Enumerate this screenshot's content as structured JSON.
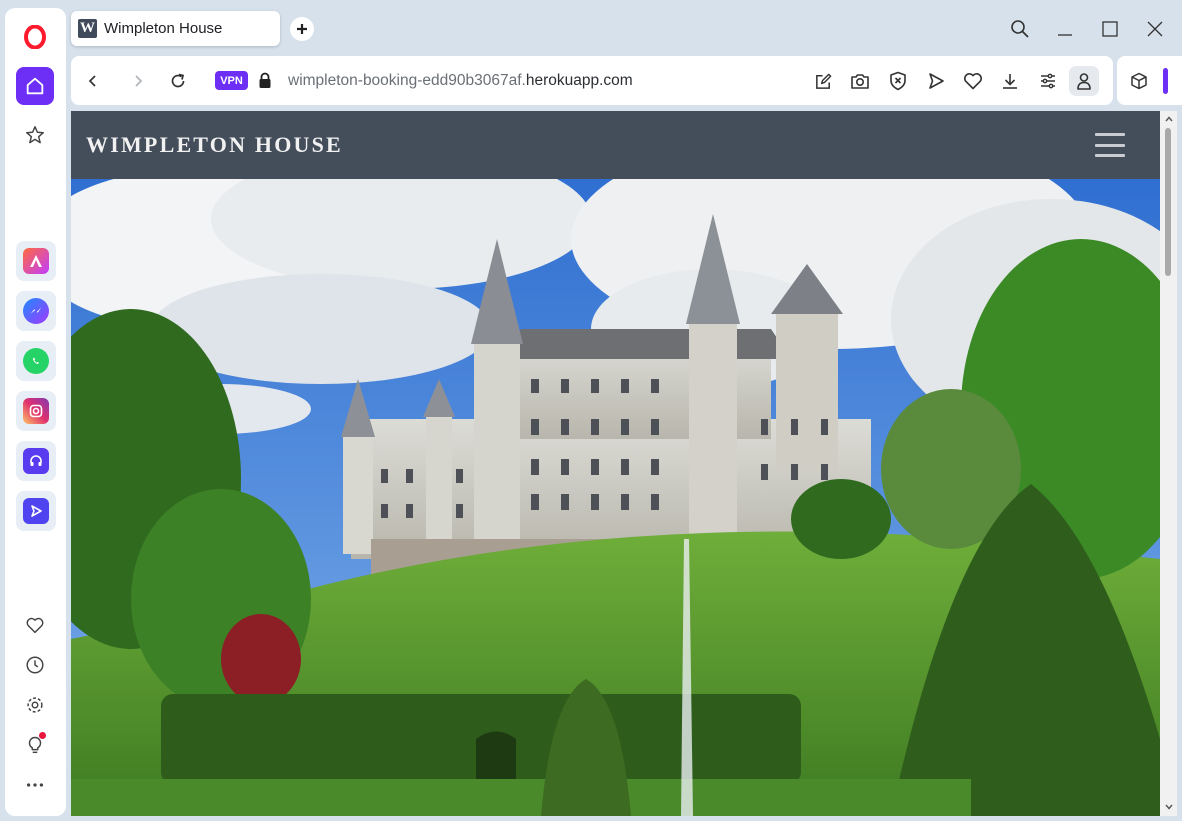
{
  "browser": {
    "tab": {
      "favicon_letter": "W",
      "title": "Wimpleton House"
    },
    "address": {
      "vpn_label": "VPN",
      "url_prefix": "wimpleton-booking-edd90b3067af.",
      "url_host": "herokuapp.com"
    },
    "toolbar_icons": [
      "edit-icon",
      "camera-icon",
      "shield-x-icon",
      "send-icon",
      "heart-icon",
      "download-icon",
      "easy-setup-icon",
      "profile-icon"
    ],
    "sidebar_apps": [
      "aria-icon",
      "messenger-icon",
      "whatsapp-icon",
      "instagram-icon",
      "music-player-icon",
      "player-icon"
    ],
    "sidebar_bottom": [
      "heart-icon",
      "history-icon",
      "settings-icon",
      "lightbulb-icon",
      "more-icon"
    ],
    "accent": "#6d2ff5"
  },
  "site": {
    "brand": "WIMPLETON HOUSE",
    "nav_bg": "#444d5a",
    "hero": "castle-with-gardens-image"
  }
}
